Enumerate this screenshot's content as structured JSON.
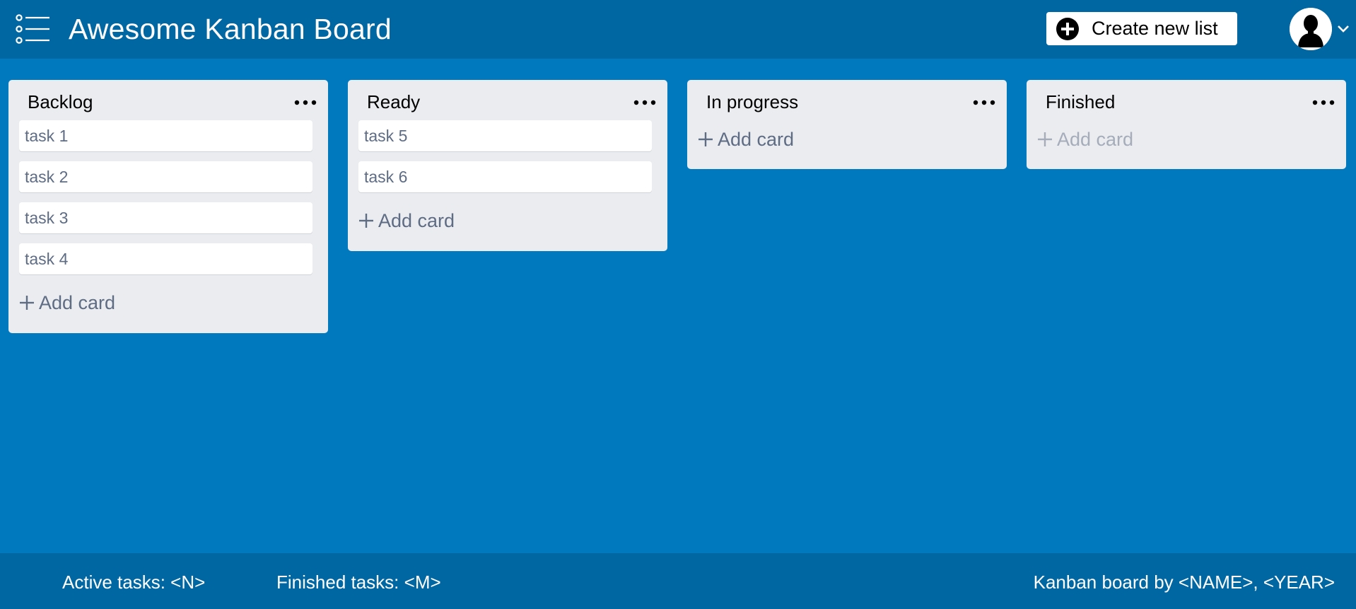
{
  "header": {
    "title": "Awesome Kanban Board",
    "create_button_label": "Create new list",
    "icons": {
      "menu": "list-menu-icon",
      "create": "plus-circle-icon",
      "avatar": "user-silhouette-icon",
      "dropdown": "chevron-down-icon"
    }
  },
  "lists": [
    {
      "title": "Backlog",
      "cards": [
        "task 1",
        "task 2",
        "task 3",
        "task 4"
      ],
      "add_card_label": "Add card"
    },
    {
      "title": "Ready",
      "cards": [
        "task 5",
        "task 6"
      ],
      "add_card_label": "Add card"
    },
    {
      "title": "In progress",
      "cards": [],
      "add_card_label": "Add card"
    },
    {
      "title": "Finished",
      "cards": [],
      "add_card_label": "Add card"
    }
  ],
  "footer": {
    "active_tasks": "Active tasks: <N>",
    "finished_tasks": "Finished tasks: <M>",
    "credit": "Kanban board by <NAME>, <YEAR>"
  },
  "colors": {
    "board_background": "#0079bf",
    "header_background": "#0067a3",
    "list_background": "#ebecf0",
    "card_background": "#ffffff",
    "muted_text": "#5e6c84",
    "disabled_text": "#a5adba"
  }
}
